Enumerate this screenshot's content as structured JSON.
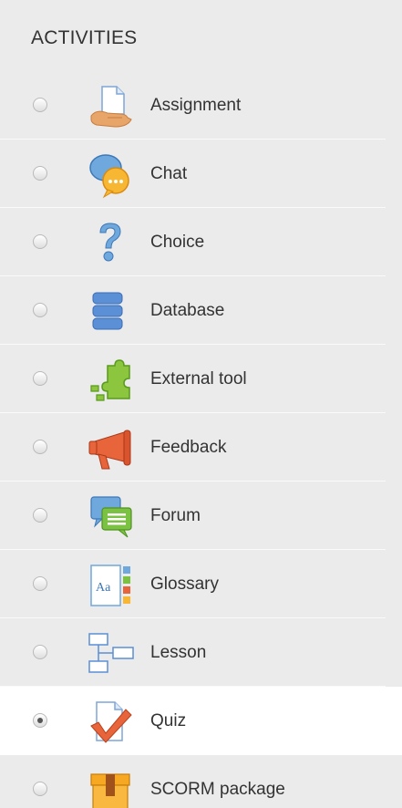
{
  "heading": "ACTIVITIES",
  "activities": [
    {
      "label": "Assignment",
      "icon": "assignment-icon",
      "selected": false
    },
    {
      "label": "Chat",
      "icon": "chat-icon",
      "selected": false
    },
    {
      "label": "Choice",
      "icon": "choice-icon",
      "selected": false
    },
    {
      "label": "Database",
      "icon": "database-icon",
      "selected": false
    },
    {
      "label": "External tool",
      "icon": "external-tool-icon",
      "selected": false
    },
    {
      "label": "Feedback",
      "icon": "feedback-icon",
      "selected": false
    },
    {
      "label": "Forum",
      "icon": "forum-icon",
      "selected": false
    },
    {
      "label": "Glossary",
      "icon": "glossary-icon",
      "selected": false
    },
    {
      "label": "Lesson",
      "icon": "lesson-icon",
      "selected": false
    },
    {
      "label": "Quiz",
      "icon": "quiz-icon",
      "selected": true
    },
    {
      "label": "SCORM package",
      "icon": "scorm-package-icon",
      "selected": false
    }
  ],
  "colors": {
    "panel_background": "#ebebeb",
    "selected_row_background": "#ffffff",
    "text": "#333333"
  }
}
